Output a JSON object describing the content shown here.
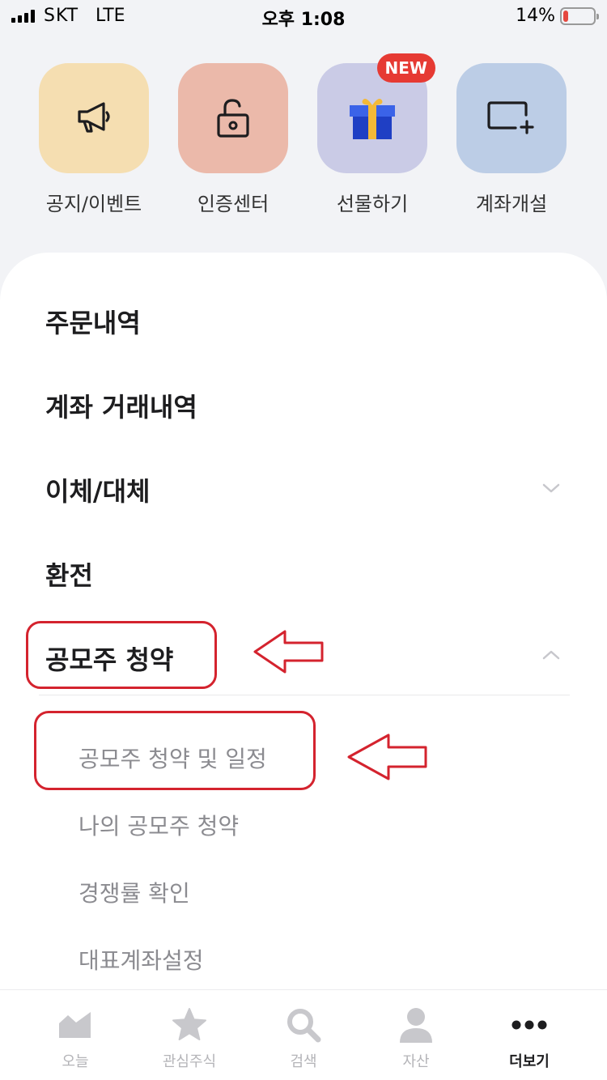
{
  "status_bar": {
    "carrier": "SKT",
    "network": "LTE",
    "time": "오후 1:08",
    "battery_percent": "14%",
    "battery_level": 0.14,
    "battery_color": "#e5483f"
  },
  "quick_actions": [
    {
      "label": "공지/이벤트",
      "icon": "megaphone-icon",
      "bg": "#f5deb1"
    },
    {
      "label": "인증센터",
      "icon": "unlock-icon",
      "bg": "#ebb9aa"
    },
    {
      "label": "선물하기",
      "icon": "gift-icon",
      "bg": "#cacbe6",
      "badge": "NEW"
    },
    {
      "label": "계좌개설",
      "icon": "add-account-icon",
      "bg": "#bccde6"
    }
  ],
  "badge_color": "#e63a33",
  "menu": {
    "order_history": "주문내역",
    "account_transactions": "계좌 거래내역",
    "transfer": "이체/대체",
    "exchange": "환전",
    "ipo_subscription": "공모주 청약",
    "ipo_sub_items": [
      "공모주 청약 및 일정",
      "나의 공모주 청약",
      "경쟁률 확인",
      "대표계좌설정"
    ]
  },
  "annotation_color": "#d4232e",
  "tab_bar": [
    {
      "label": "오늘",
      "icon": "chart-icon",
      "active": false
    },
    {
      "label": "관심주식",
      "icon": "star-icon",
      "active": false
    },
    {
      "label": "검색",
      "icon": "search-icon",
      "active": false
    },
    {
      "label": "자산",
      "icon": "person-icon",
      "active": false
    },
    {
      "label": "더보기",
      "icon": "more-icon",
      "active": true
    }
  ]
}
